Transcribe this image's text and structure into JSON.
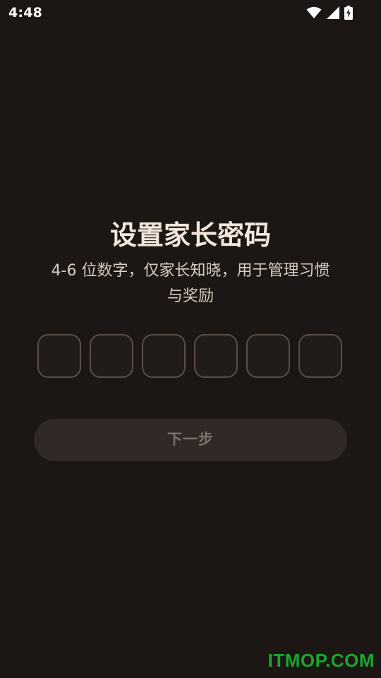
{
  "status_bar": {
    "time": "4:48",
    "icons": [
      "wifi-icon",
      "cellular-signal-icon",
      "battery-charging-icon"
    ]
  },
  "main": {
    "title": "设置家长密码",
    "subtitle_line1": "4-6 位数字，仅家长知晓，用于管理习惯",
    "subtitle_line2": "与奖励",
    "code_slots": [
      "",
      "",
      "",
      "",
      "",
      ""
    ],
    "next_button_label": "下一步"
  },
  "watermark": {
    "text": "ITMOP.COM"
  },
  "colors": {
    "background": "#1c1614",
    "title": "#f3e6da",
    "box_border": "#5a4e47",
    "button_bg": "#302926",
    "button_text": "#7d716a",
    "watermark": "#1aa52c"
  }
}
